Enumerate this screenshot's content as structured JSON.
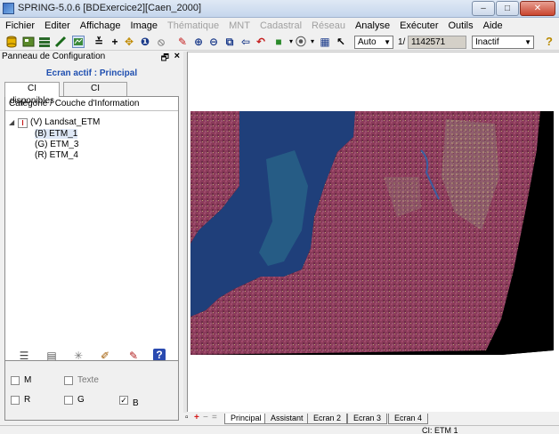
{
  "window": {
    "title": "SPRING-5.0.6 [BDExercice2][Caen_2000]",
    "minimize": "–",
    "maximize": "□",
    "close": "✕"
  },
  "menu": [
    {
      "label": "Fichier",
      "enabled": true
    },
    {
      "label": "Editer",
      "enabled": true
    },
    {
      "label": "Affichage",
      "enabled": true
    },
    {
      "label": "Image",
      "enabled": true
    },
    {
      "label": "Thématique",
      "enabled": false
    },
    {
      "label": "MNT",
      "enabled": false
    },
    {
      "label": "Cadastral",
      "enabled": false
    },
    {
      "label": "Réseau",
      "enabled": false
    },
    {
      "label": "Analyse",
      "enabled": true
    },
    {
      "label": "Exécuter",
      "enabled": true
    },
    {
      "label": "Outils",
      "enabled": true
    },
    {
      "label": "Aide",
      "enabled": true
    }
  ],
  "toolbar": {
    "scale_mode": "Auto",
    "scale_prefix": "1/",
    "scale_value": "1142571",
    "state": "Inactif",
    "help_icon": "?"
  },
  "panel": {
    "title": "Panneau de Configuration",
    "active_screen": "Ecran actif : Principal",
    "tabs": [
      "CI disponibles",
      "CI sélectionnées"
    ],
    "tree_header": "Catégorie / Couche d'Information",
    "tree": {
      "root_expander": "◢",
      "root_badge": "I",
      "root": "(V) Landsat_ETM",
      "children": [
        "(B) ETM_1",
        "(G) ETM_3",
        "(R) ETM_4"
      ]
    },
    "checkboxes": {
      "m": {
        "label": "M",
        "checked": false
      },
      "texte": {
        "label": "Texte",
        "checked": false
      },
      "r": {
        "label": "R",
        "checked": false
      },
      "g": {
        "label": "G",
        "checked": false
      },
      "b": {
        "label": "B",
        "checked": true,
        "mark": "✓"
      }
    }
  },
  "bottom_tabs": [
    "Principal",
    "Assistant",
    "Ecran 2",
    "Ecran 3",
    "Ecran 4"
  ],
  "status": {
    "text": "CI: ETM 1"
  },
  "colors": {
    "accent": "#1f4fb0",
    "land": "#8a3b5a",
    "sea": "#1f3f7a"
  }
}
